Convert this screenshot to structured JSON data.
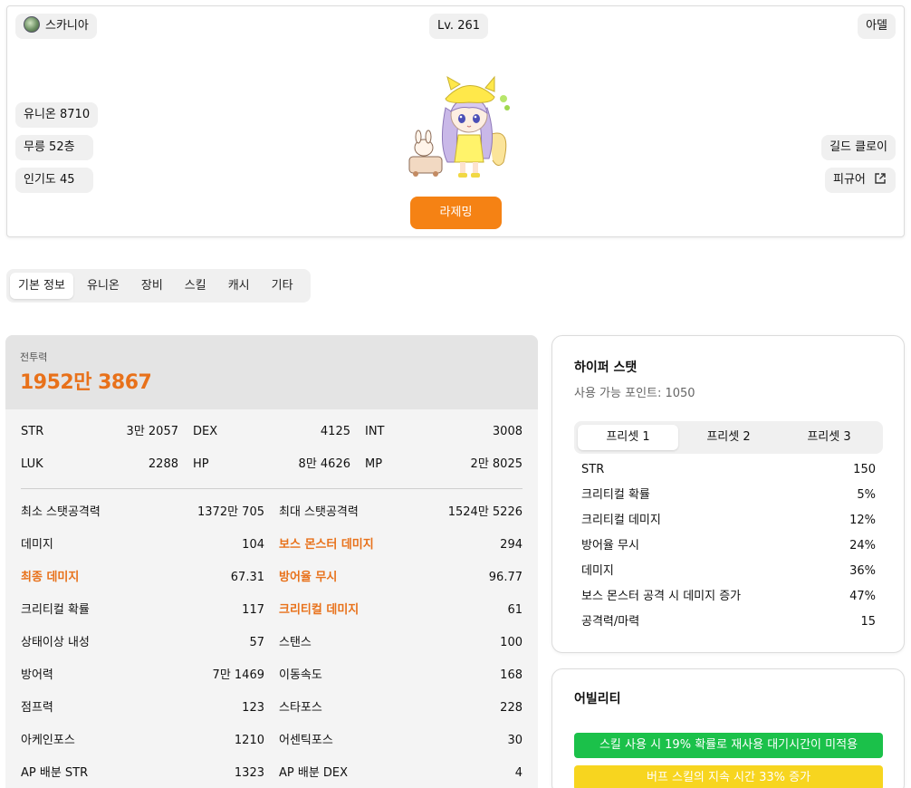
{
  "profile": {
    "world": "스카니아",
    "level": "Lv. 261",
    "name": "아델",
    "union": "유니온 8710",
    "dojang": "무릉 52층",
    "popularity": "인기도 45",
    "guild": "길드 클로이",
    "figure": "피규어",
    "relaunch_label": "라제밍",
    "accent_color": "#f58214"
  },
  "tabs": [
    "기본 정보",
    "유니온",
    "장비",
    "스킬",
    "캐시",
    "기타"
  ],
  "active_tab": "기본 정보",
  "stats": {
    "combat_power_label": "전투력",
    "combat_power": "1952만 3867",
    "primary": [
      {
        "label": "STR",
        "value": "3만 2057"
      },
      {
        "label": "DEX",
        "value": "4125"
      },
      {
        "label": "INT",
        "value": "3008"
      },
      {
        "label": "LUK",
        "value": "2288"
      },
      {
        "label": "HP",
        "value": "8만 4626"
      },
      {
        "label": "MP",
        "value": "2만 8025"
      }
    ],
    "detail": [
      {
        "label": "최소 스탯공격력",
        "value": "1372만 705",
        "highlight": false
      },
      {
        "label": "최대 스탯공격력",
        "value": "1524만 5226",
        "highlight": false
      },
      {
        "label": "데미지",
        "value": "104",
        "highlight": false
      },
      {
        "label": "보스 몬스터 데미지",
        "value": "294",
        "highlight": true
      },
      {
        "label": "최종 데미지",
        "value": "67.31",
        "highlight": true
      },
      {
        "label": "방어율 무시",
        "value": "96.77",
        "highlight": true
      },
      {
        "label": "크리티컬 확률",
        "value": "117",
        "highlight": false
      },
      {
        "label": "크리티컬 데미지",
        "value": "61",
        "highlight": true
      },
      {
        "label": "상태이상 내성",
        "value": "57",
        "highlight": false
      },
      {
        "label": "스탠스",
        "value": "100",
        "highlight": false
      },
      {
        "label": "방어력",
        "value": "7만 1469",
        "highlight": false
      },
      {
        "label": "이동속도",
        "value": "168",
        "highlight": false
      },
      {
        "label": "점프력",
        "value": "123",
        "highlight": false
      },
      {
        "label": "스타포스",
        "value": "228",
        "highlight": false
      },
      {
        "label": "아케인포스",
        "value": "1210",
        "highlight": false
      },
      {
        "label": "어센틱포스",
        "value": "30",
        "highlight": false
      },
      {
        "label": "AP 배분 STR",
        "value": "1323",
        "highlight": false
      },
      {
        "label": "AP 배분 DEX",
        "value": "4",
        "highlight": false
      }
    ]
  },
  "hyper": {
    "title": "하이퍼 스탯",
    "points": "사용 가능 포인트: 1050",
    "presets": [
      "프리셋 1",
      "프리셋 2",
      "프리셋 3"
    ],
    "active_preset": "프리셋 1",
    "rows": [
      {
        "label": "STR",
        "value": "150"
      },
      {
        "label": "크리티컬 확률",
        "value": "5%"
      },
      {
        "label": "크리티컬 데미지",
        "value": "12%"
      },
      {
        "label": "방어율 무시",
        "value": "24%"
      },
      {
        "label": "데미지",
        "value": "36%"
      },
      {
        "label": "보스 몬스터 공격 시 데미지 증가",
        "value": "47%"
      },
      {
        "label": "공격력/마력",
        "value": "15"
      }
    ]
  },
  "ability": {
    "title": "어빌리티",
    "lines": [
      {
        "text": "스킬 사용 시 19% 확률로 재사용 대기시간이 미적용",
        "color": "#1bc14a"
      },
      {
        "text": "버프 스킬의 지속 시간 33% 증가",
        "color": "#f7d51f"
      }
    ]
  }
}
